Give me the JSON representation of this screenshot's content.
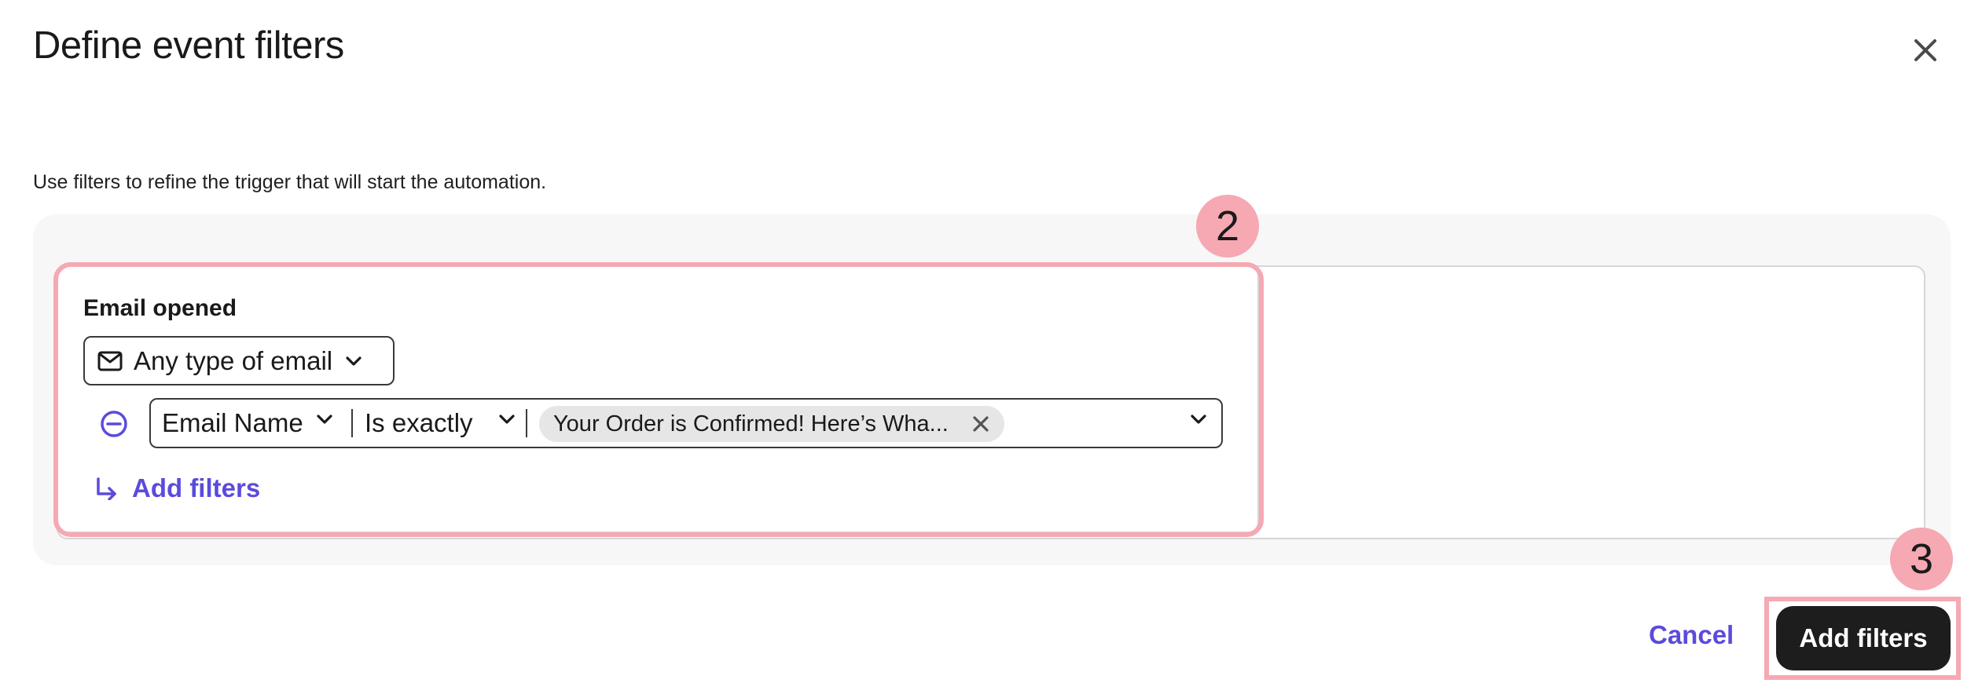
{
  "dialog": {
    "title": "Define event filters",
    "subtitle": "Use filters to refine the trigger that will start the automation."
  },
  "icons": {
    "close": "close-icon",
    "mail": "mail-icon",
    "chevron": "chevron-down-icon",
    "remove": "minus-circle-icon",
    "chip_remove": "x-icon",
    "add_filter": "arrow-turn-down-right-icon"
  },
  "filter_card": {
    "title": "Email opened",
    "email_type": "Any type of email",
    "condition": {
      "field": "Email Name",
      "operator": "Is exactly",
      "value": "Your Order is Confirmed! Here’s Wha..."
    },
    "add_filter_label": "Add filters"
  },
  "annotations": {
    "step_2": "2",
    "step_3": "3"
  },
  "footer": {
    "cancel_label": "Cancel",
    "submit_label": "Add filters"
  },
  "colors": {
    "accent": "#5b4bdb",
    "highlight": "#f6a8b3",
    "primary_button": "#1d1d1d",
    "panel_background": "#f7f7f7"
  }
}
